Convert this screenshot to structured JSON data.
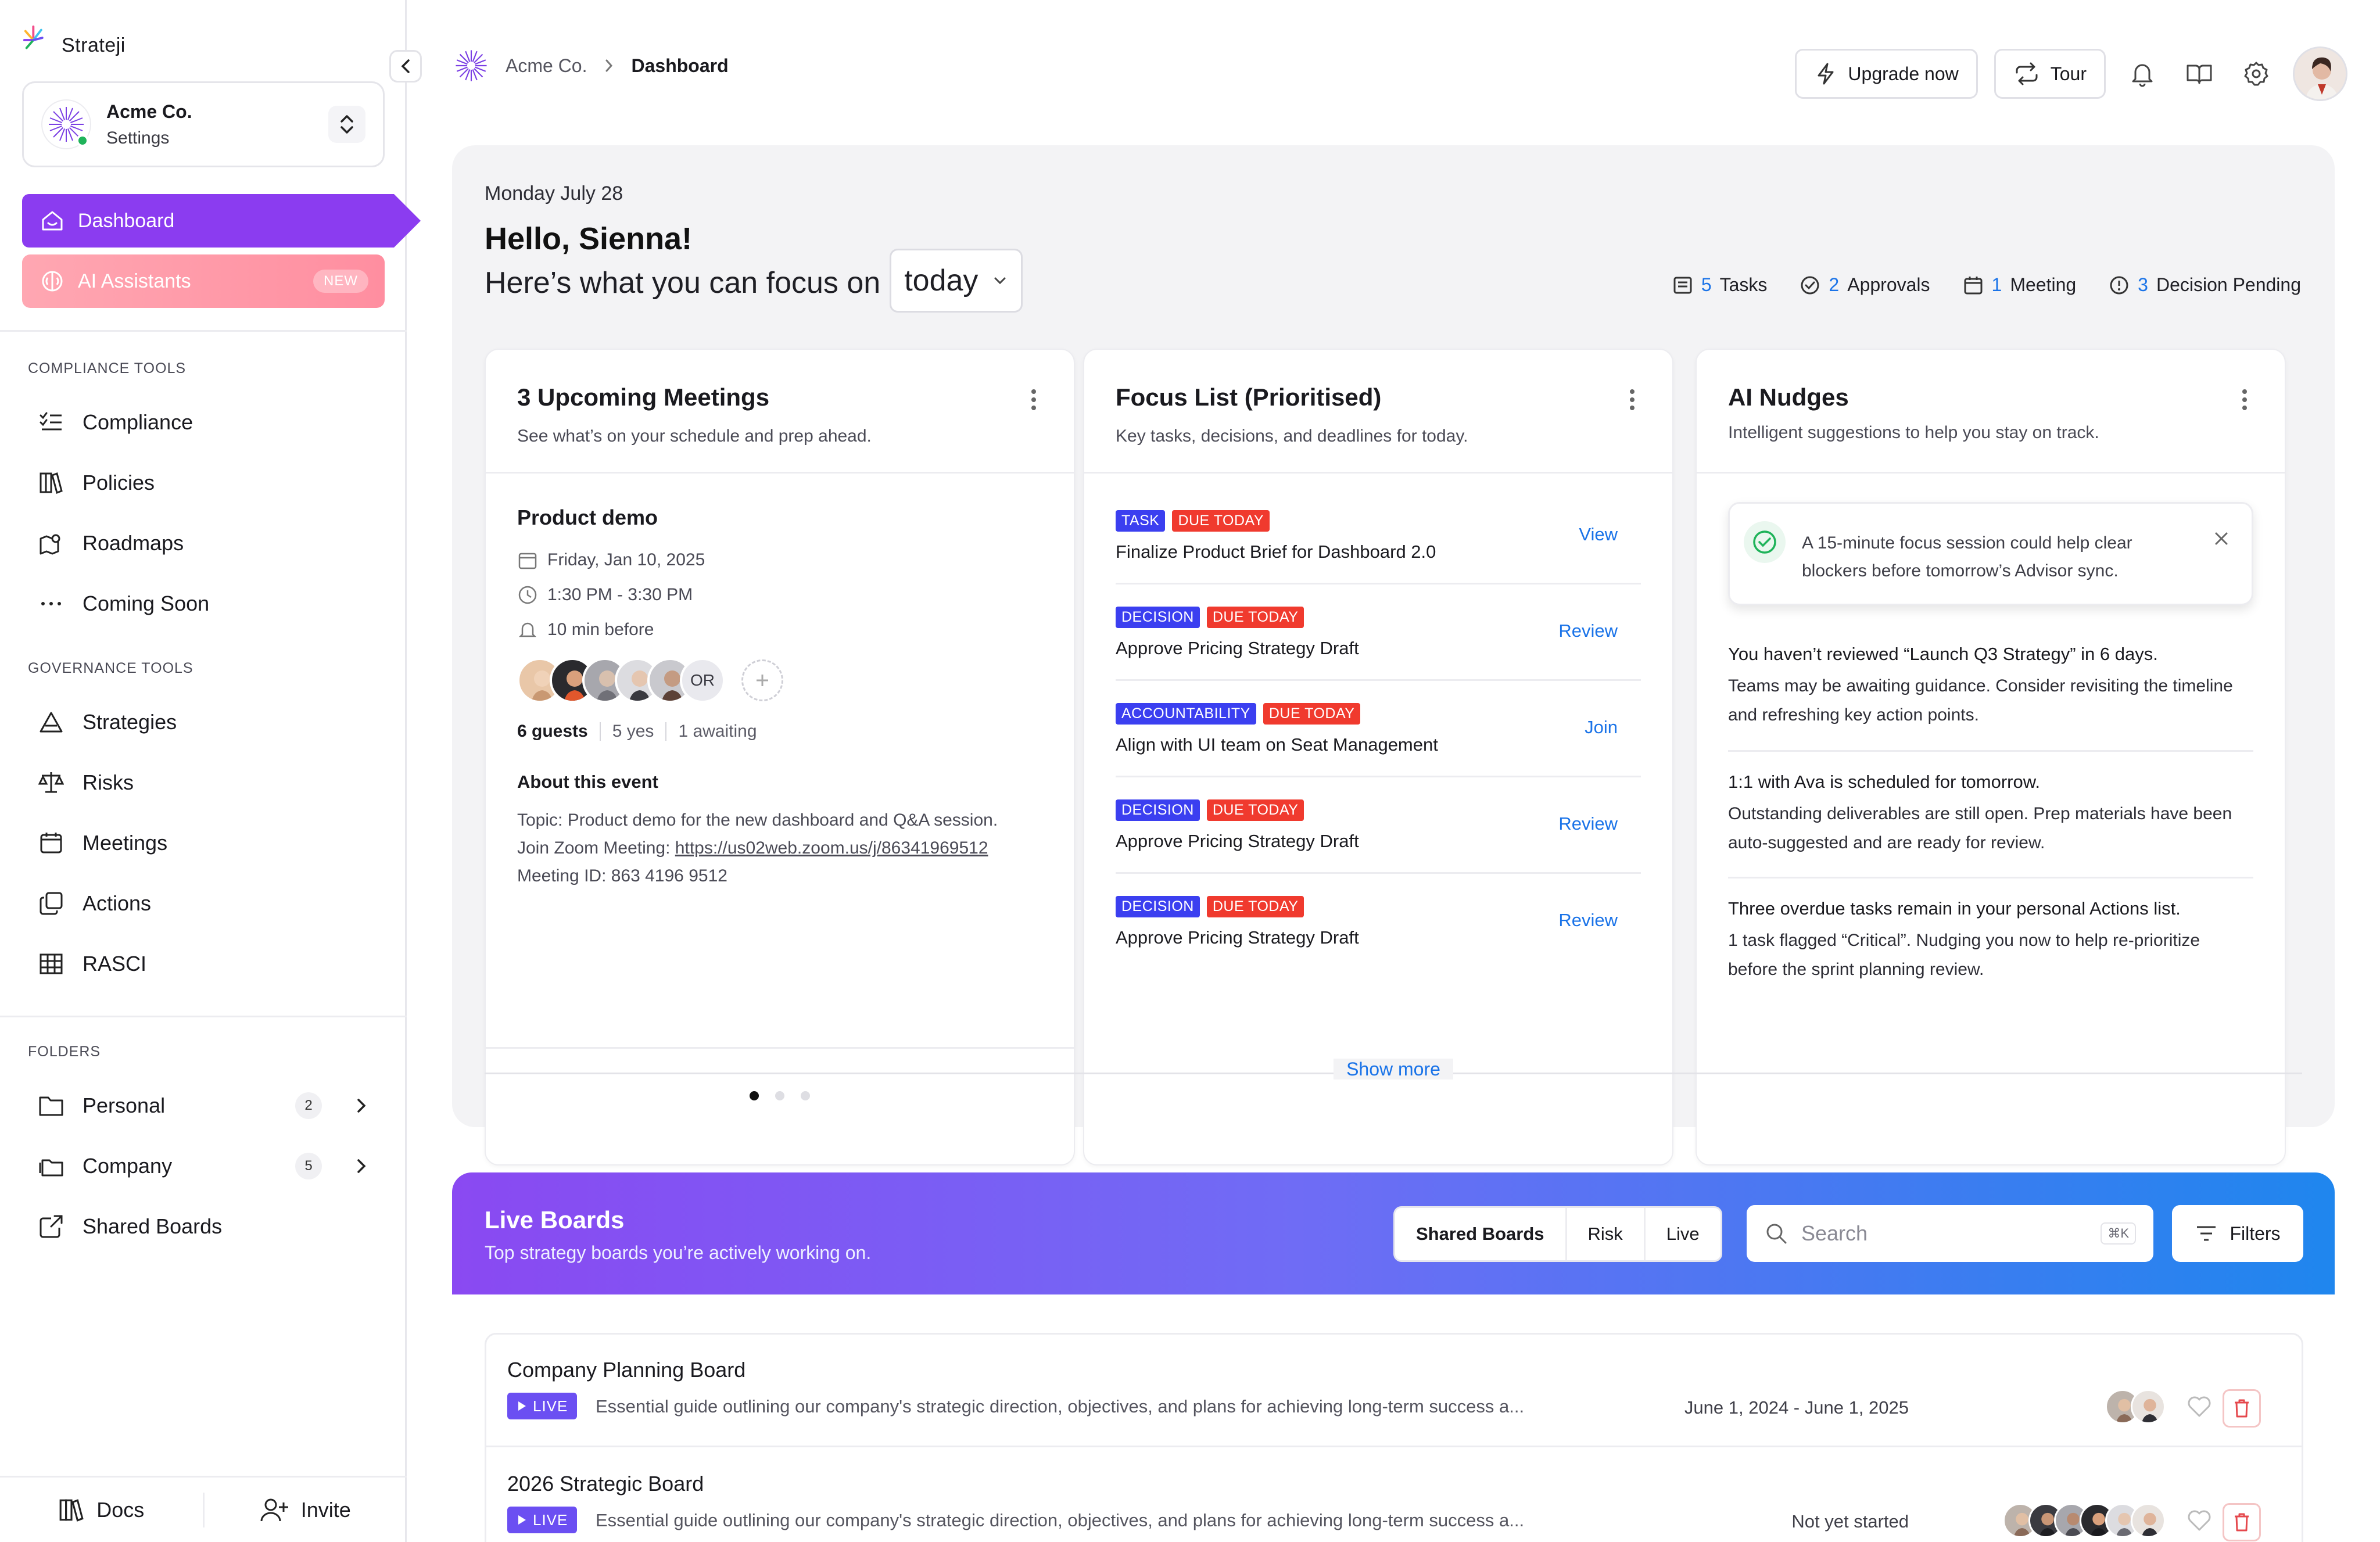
{
  "app": {
    "brand": "Strateji"
  },
  "org": {
    "name": "Acme Co.",
    "sub": "Settings"
  },
  "nav": {
    "dashboard": "Dashboard",
    "ai_assistants": "AI Assistants",
    "ai_badge": "NEW"
  },
  "sections": {
    "compliance": "COMPLIANCE TOOLS",
    "governance": "GOVERNANCE TOOLS",
    "folders": "FOLDERS"
  },
  "compliance_items": [
    "Compliance",
    "Policies",
    "Roadmaps",
    "Coming Soon"
  ],
  "governance_items": [
    "Strategies",
    "Risks",
    "Meetings",
    "Actions",
    "RASCI"
  ],
  "folders": [
    {
      "label": "Personal",
      "count": "2"
    },
    {
      "label": "Company",
      "count": "5"
    },
    {
      "label": "Shared Boards",
      "count": ""
    }
  ],
  "footer": {
    "docs": "Docs",
    "invite": "Invite"
  },
  "breadcrumb": {
    "org": "Acme Co.",
    "current": "Dashboard"
  },
  "toolbar": {
    "upgrade": "Upgrade now",
    "tour": "Tour"
  },
  "focus": {
    "date": "Monday July 28",
    "greeting": "Hello, Sienna!",
    "prompt": "Here’s what you can focus on",
    "period": "today",
    "stats": [
      {
        "num": "5",
        "label": "Tasks"
      },
      {
        "num": "2",
        "label": "Approvals"
      },
      {
        "num": "1",
        "label": "Meeting"
      },
      {
        "num": "3",
        "label": "Decision Pending"
      }
    ],
    "show_more": "Show more"
  },
  "meetings_card": {
    "title": "3 Upcoming Meetings",
    "subtitle": "See what’s on your schedule and prep ahead.",
    "event": {
      "title": "Product demo",
      "date": "Friday, Jan 10, 2025",
      "time": "1:30 PM - 3:30 PM",
      "reminder": "10 min before",
      "or_initials": "OR",
      "guests": "6 guests",
      "yes": "5 yes",
      "awaiting": "1 awaiting",
      "about_title": "About this event",
      "topic": "Topic: Product demo for the new dashboard and Q&A session.",
      "zoom_label": "Join Zoom Meeting: ",
      "zoom_url": "https://us02web.zoom.us/j/86341969512",
      "meeting_id": "Meeting ID: 863 4196 9512"
    }
  },
  "focus_list": {
    "title": "Focus List (Prioritised)",
    "subtitle": "Key tasks, decisions, and deadlines for today.",
    "items": [
      {
        "type": "TASK",
        "due": "DUE TODAY",
        "text": "Finalize Product Brief for Dashboard 2.0",
        "action": "View"
      },
      {
        "type": "DECISION",
        "due": "DUE TODAY",
        "text": "Approve Pricing Strategy Draft",
        "action": "Review"
      },
      {
        "type": "ACCOUNTABILITY",
        "due": "DUE TODAY",
        "text": "Align with UI team on Seat Management",
        "action": "Join"
      },
      {
        "type": "DECISION",
        "due": "DUE TODAY",
        "text": "Approve Pricing Strategy Draft",
        "action": "Review"
      },
      {
        "type": "DECISION",
        "due": "DUE TODAY",
        "text": "Approve Pricing Strategy Draft",
        "action": "Review"
      }
    ]
  },
  "nudges": {
    "title": "AI Nudges",
    "subtitle": "Intelligent suggestions to help you stay on track.",
    "toast": "A 15-minute focus session could help clear blockers before tomorrow’s Advisor sync.",
    "items": [
      {
        "head": "You haven’t reviewed “Launch Q3 Strategy” in 6 days.",
        "body": "Teams may be awaiting guidance. Consider revisiting the timeline and refreshing key action points."
      },
      {
        "head": "1:1 with Ava is scheduled for tomorrow.",
        "body": "Outstanding deliverables are still open. Prep materials have been auto-suggested and are ready for review."
      },
      {
        "head": "Three overdue tasks remain in your personal Actions list.",
        "body": "1 task flagged “Critical”. Nudging you now to help re-prioritize before the sprint planning review."
      }
    ]
  },
  "live_boards": {
    "title": "Live Boards",
    "subtitle": "Top strategy boards you’re actively working on.",
    "segments": [
      "Shared Boards",
      "Risk",
      "Live"
    ],
    "search_placeholder": "Search",
    "search_kbd": "⌘K",
    "filters": "Filters",
    "live_badge": "LIVE",
    "boards": [
      {
        "name": "Company Planning Board",
        "desc": "Essential guide outlining our company's strategic direction, objectives, and plans for achieving long-term success a...",
        "date": "June 1, 2024 - June 1, 2025"
      },
      {
        "name": "2026 Strategic Board",
        "desc": "Essential guide outlining our company's strategic direction, objectives, and plans for achieving long-term success a...",
        "date": "Not yet started"
      }
    ]
  },
  "colors": {
    "accent": "#8b3cf0",
    "link": "#1a73e8",
    "tag_blue": "#3b3ff0",
    "tag_red": "#f03a2e",
    "ai_pink": "#ff98a8"
  }
}
